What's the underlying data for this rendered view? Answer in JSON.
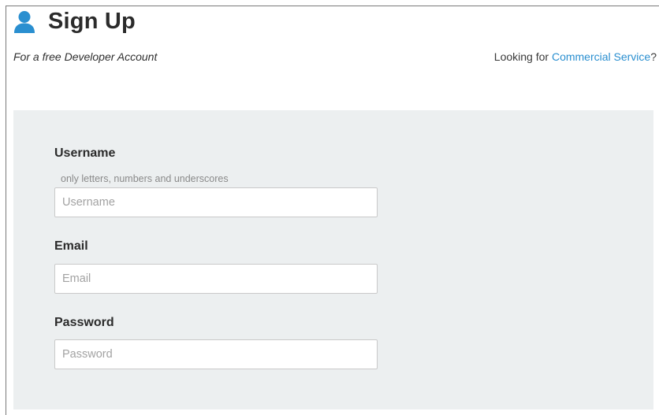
{
  "header": {
    "icon": "user-icon",
    "title": "Sign Up",
    "subtitle": "For a free Developer Account",
    "commercial_prefix": "Looking for ",
    "commercial_link": "Commercial Service",
    "commercial_suffix": "?"
  },
  "form": {
    "username": {
      "label": "Username",
      "hint": "only letters, numbers and underscores",
      "placeholder": "Username",
      "value": ""
    },
    "email": {
      "label": "Email",
      "placeholder": "Email",
      "value": ""
    },
    "password": {
      "label": "Password",
      "placeholder": "Password",
      "value": ""
    }
  },
  "colors": {
    "accent": "#2a8fd0",
    "panel_background": "#eceff0",
    "text": "#2b2b2b"
  }
}
